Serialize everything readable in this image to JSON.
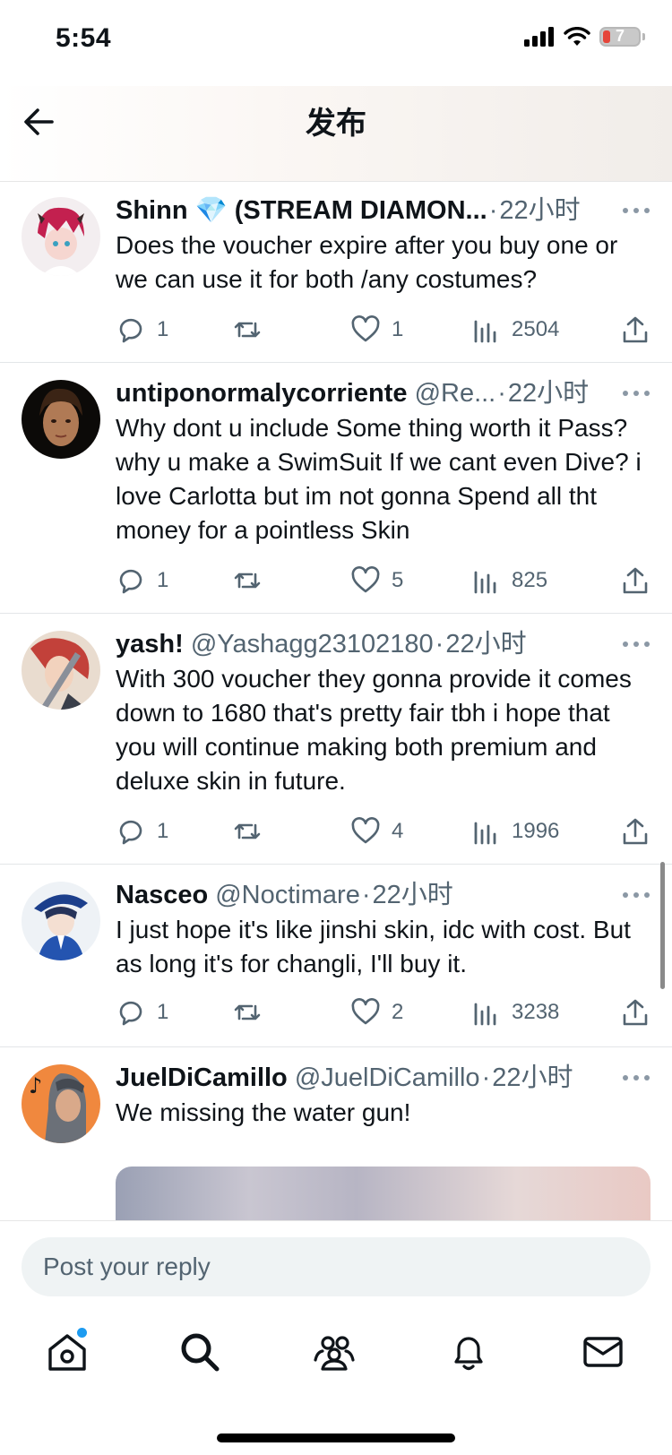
{
  "status": {
    "time": "5:54",
    "battery": "7"
  },
  "header": {
    "title": "发布"
  },
  "replies": [
    {
      "name": "Shinn 💎 (STREAM DIAMON...",
      "handle": "",
      "time": "22小时",
      "text": "Does the voucher expire after you buy one or we can use it for both /any costumes?",
      "stats": {
        "replies": "1",
        "reposts": "",
        "likes": "1",
        "views": "2504"
      }
    },
    {
      "name": "untiponormalycorriente",
      "handle": "@Re...",
      "time": "22小时",
      "text": "Why dont u include Some thing worth it Pass? why u make a SwimSuit If we cant even Dive? i love Carlotta but im not gonna Spend all tht money for a pointless Skin",
      "stats": {
        "replies": "1",
        "reposts": "",
        "likes": "5",
        "views": "825"
      }
    },
    {
      "name": "yash!",
      "handle": "@Yashagg23102180",
      "time": "22小时",
      "text": "With 300 voucher they gonna provide it comes down to 1680 that's pretty fair tbh i hope that you will continue making both premium and deluxe skin in future.",
      "stats": {
        "replies": "1",
        "reposts": "",
        "likes": "4",
        "views": "1996"
      }
    },
    {
      "name": "Nasceo",
      "handle": "@Noctimare",
      "time": "22小时",
      "text": "I just hope it's like jinshi skin, idc with cost. But as long it's for changli, I'll buy it.",
      "stats": {
        "replies": "1",
        "reposts": "",
        "likes": "2",
        "views": "3238"
      }
    },
    {
      "name": "JuelDiCamillo",
      "handle": "@JuelDiCamillo",
      "time": "22小时",
      "text": "We missing the water gun!",
      "stats": {
        "replies": "",
        "reposts": "",
        "likes": "",
        "views": ""
      }
    }
  ],
  "compose": {
    "placeholder": "Post your reply"
  },
  "tabs": [
    "home-icon",
    "search-icon",
    "communities-icon",
    "notifications-icon",
    "messages-icon"
  ],
  "colors": {
    "accent": "#1d9bf0",
    "text": "#0f1419",
    "secondary": "#536471"
  }
}
